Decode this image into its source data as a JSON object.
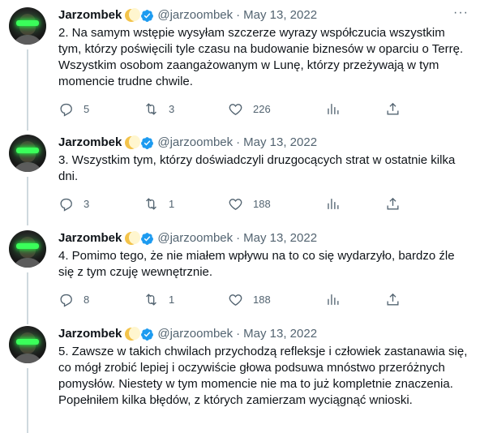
{
  "author": {
    "name": "Jarzombek",
    "handle": "@jarzoombek",
    "date": "May 13, 2022"
  },
  "separator": "·",
  "more_label": "···",
  "tweets": [
    {
      "text": "2. Na samym wstępie wysyłam szczerze wyrazy współczucia wszystkim tym, którzy poświęcili tyle czasu na budowanie biznesów w oparciu o Terrę. Wszystkim osobom zaangażowanym w Lunę, którzy przeżywają w tym momencie trudne chwile.",
      "replies": "5",
      "retweets": "3",
      "likes": "226"
    },
    {
      "text": "3. Wszystkim tym, którzy doświadczyli druzgocących strat w ostatnie kilka dni.",
      "replies": "3",
      "retweets": "1",
      "likes": "188"
    },
    {
      "text": "4. Pomimo tego, że nie miałem wpływu na to co się wydarzyło, bardzo źle się z tym czuję wewnętrznie.",
      "replies": "8",
      "retweets": "1",
      "likes": "188"
    },
    {
      "text": "5. Zawsze w takich chwilach przychodzą refleksje i człowiek zastanawia się, co mógł zrobić lepiej i oczywiście głowa podsuwa mnóstwo przeróżnych pomysłów. Niestety w tym momencie nie ma to już kompletnie znaczenia. Popełniłem kilka błędów, z których zamierzam wyciągnąć wnioski."
    }
  ],
  "icons": {
    "reply": "reply-icon",
    "retweet": "retweet-icon",
    "like": "heart-icon",
    "views": "analytics-icon",
    "share": "share-icon",
    "verified": "verified-badge-icon",
    "moon": "moon-emoji-icon"
  },
  "colors": {
    "text": "#0f1419",
    "secondary": "#536471",
    "verified": "#1d9bf0",
    "thread_line": "#cfd9de"
  }
}
